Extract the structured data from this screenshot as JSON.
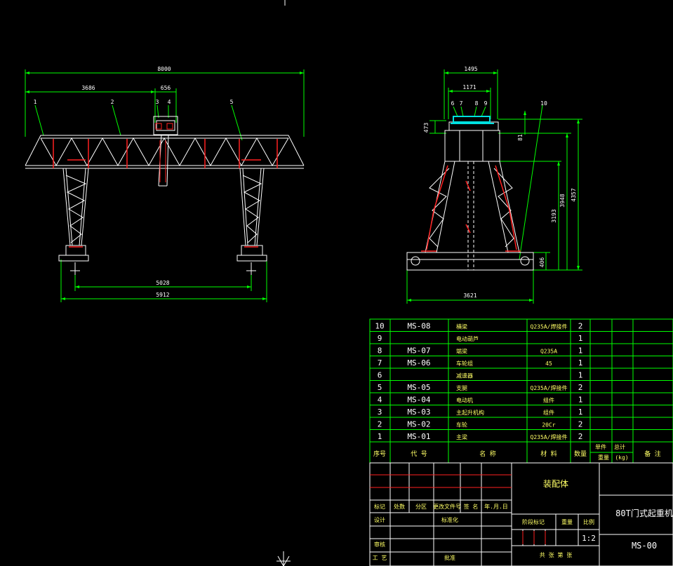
{
  "front_view": {
    "dims": {
      "overall": "8000",
      "left_span": "3686",
      "trolley": "656",
      "rail_span": "5028",
      "base_span": "5912"
    },
    "balloons": [
      "1",
      "2",
      "3",
      "4",
      "5"
    ]
  },
  "side_view": {
    "dims": {
      "top_width": "1495",
      "inner_width": "1171",
      "base_width": "3621",
      "h_small": "473",
      "h_81": "81",
      "h_3193": "3193",
      "h_3948": "3948",
      "h_4357": "4357",
      "h_406": "406"
    },
    "balloons": [
      "6",
      "7",
      "8",
      "9",
      "10"
    ]
  },
  "parts_list": {
    "rows": [
      {
        "no": "10",
        "code": "MS-08",
        "name": "横梁",
        "material": "Q235A/焊接件",
        "qty": "2"
      },
      {
        "no": "9",
        "code": "",
        "name": "电动葫芦",
        "material": "",
        "qty": "1"
      },
      {
        "no": "8",
        "code": "MS-07",
        "name": "端梁",
        "material": "Q235A",
        "qty": "1"
      },
      {
        "no": "7",
        "code": "MS-06",
        "name": "车轮组",
        "material": "45",
        "qty": "1"
      },
      {
        "no": "6",
        "code": "",
        "name": "减速器",
        "material": "",
        "qty": "1"
      },
      {
        "no": "5",
        "code": "MS-05",
        "name": "支腿",
        "material": "Q235A/焊接件",
        "qty": "2"
      },
      {
        "no": "4",
        "code": "MS-04",
        "name": "电动机",
        "material": "组件",
        "qty": "1"
      },
      {
        "no": "3",
        "code": "MS-03",
        "name": "主起升机构",
        "material": "组件",
        "qty": "1"
      },
      {
        "no": "2",
        "code": "MS-02",
        "name": "车轮",
        "material": "20Cr",
        "qty": "2"
      },
      {
        "no": "1",
        "code": "MS-01",
        "name": "主梁",
        "material": "Q235A/焊接件",
        "qty": "2"
      }
    ],
    "header": {
      "no": "序号",
      "code": "代  号",
      "name": "名    称",
      "material": "材  料",
      "qty": "数量",
      "unit_weight": "单件",
      "total_weight": "总计",
      "weight": "重量",
      "kg": "(kg)",
      "remark": "备  注"
    }
  },
  "title_block": {
    "assembly": "装配体",
    "title": "80T门式起重机",
    "drawing_no": "MS-00",
    "scale": "1:2",
    "rev_headers": [
      "标记",
      "处数",
      "分区",
      "更改文件号",
      "签  名",
      "年.月.日"
    ],
    "design": "设计",
    "standardize": "标准化",
    "review": "审核",
    "process": "工  艺",
    "approve": "批准",
    "stage_mark": "阶段标记",
    "weight": "重量",
    "ratio": "比例",
    "sheets": "共    张    第    张"
  },
  "colors": {
    "background": "#000000",
    "lines": "#ffffff",
    "green": "#00ff00",
    "red": "#ff2020",
    "cyan": "#00e0e0",
    "yellow": "#ffff66"
  }
}
